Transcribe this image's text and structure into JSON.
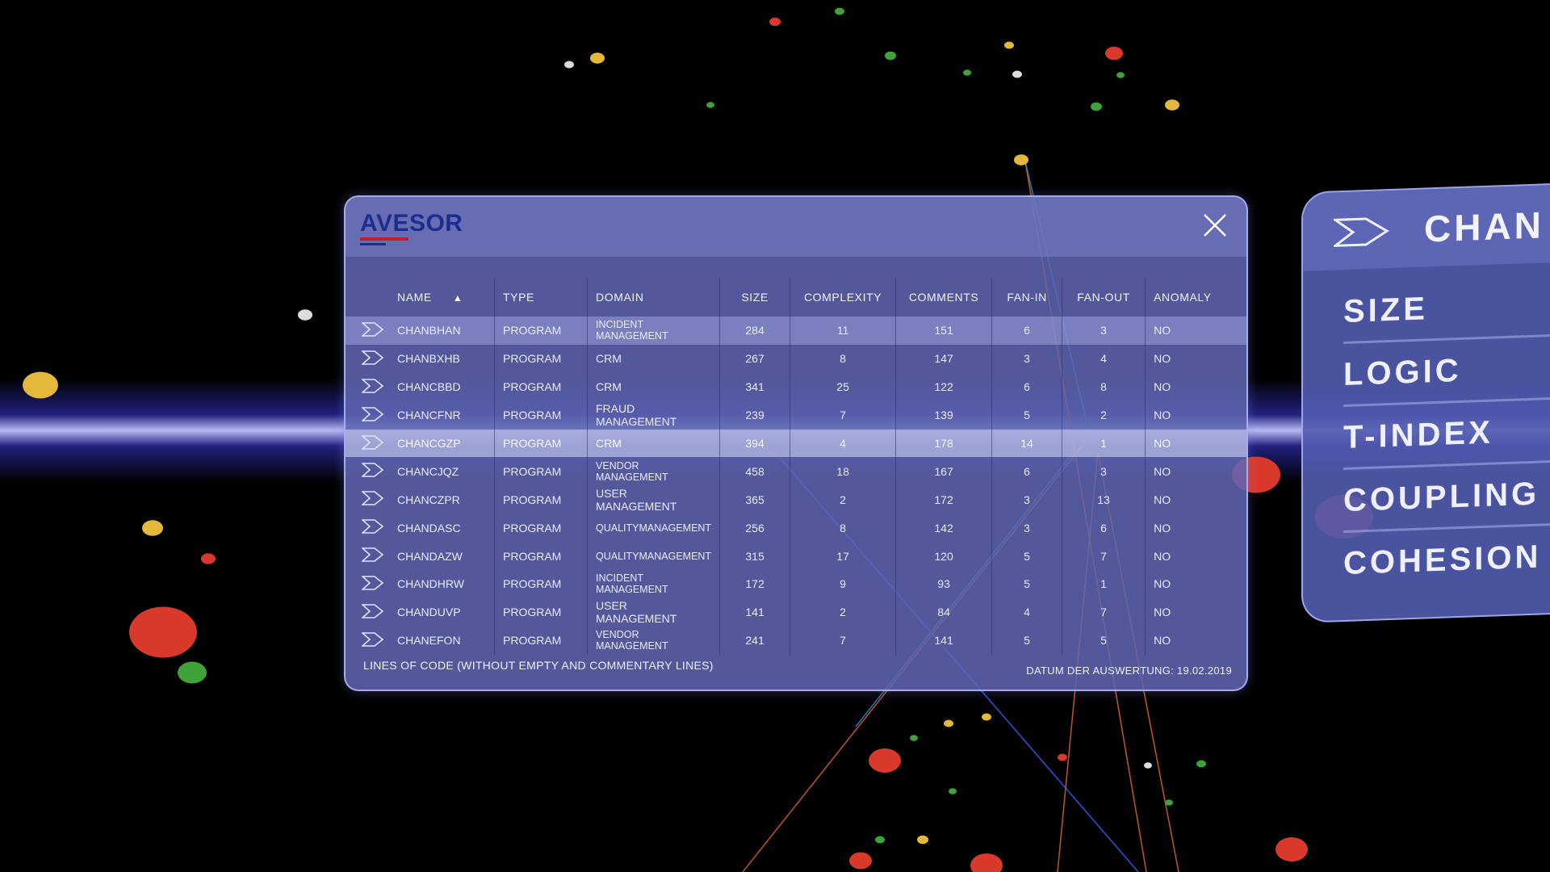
{
  "panel": {
    "logo_text": "AVESOR",
    "columns": [
      "NAME",
      "TYPE",
      "DOMAIN",
      "SIZE",
      "COMPLEXITY",
      "COMMENTS",
      "FAN-IN",
      "FAN-OUT",
      "ANOMALY"
    ],
    "rows": [
      {
        "name": "CHANBHAN",
        "type": "PROGRAM",
        "domain": "INCIDENT MANAGEMENT",
        "size": "284",
        "complexity": "11",
        "comments": "151",
        "fan_in": "6",
        "fan_out": "3",
        "anomaly": "NO"
      },
      {
        "name": "CHANBXHB",
        "type": "PROGRAM",
        "domain": "CRM",
        "size": "267",
        "complexity": "8",
        "comments": "147",
        "fan_in": "3",
        "fan_out": "4",
        "anomaly": "NO"
      },
      {
        "name": "CHANCBBD",
        "type": "PROGRAM",
        "domain": "CRM",
        "size": "341",
        "complexity": "25",
        "comments": "122",
        "fan_in": "6",
        "fan_out": "8",
        "anomaly": "NO"
      },
      {
        "name": "CHANCFNR",
        "type": "PROGRAM",
        "domain": "FRAUD MANAGEMENT",
        "size": "239",
        "complexity": "7",
        "comments": "139",
        "fan_in": "5",
        "fan_out": "2",
        "anomaly": "NO"
      },
      {
        "name": "CHANCGZP",
        "type": "PROGRAM",
        "domain": "CRM",
        "size": "394",
        "complexity": "4",
        "comments": "178",
        "fan_in": "14",
        "fan_out": "1",
        "anomaly": "NO"
      },
      {
        "name": "CHANCJQZ",
        "type": "PROGRAM",
        "domain": "VENDOR MANAGEMENT",
        "size": "458",
        "complexity": "18",
        "comments": "167",
        "fan_in": "6",
        "fan_out": "3",
        "anomaly": "NO"
      },
      {
        "name": "CHANCZPR",
        "type": "PROGRAM",
        "domain": "USER MANAGEMENT",
        "size": "365",
        "complexity": "2",
        "comments": "172",
        "fan_in": "3",
        "fan_out": "13",
        "anomaly": "NO"
      },
      {
        "name": "CHANDASC",
        "type": "PROGRAM",
        "domain": "QUALITYMANAGEMENT",
        "size": "256",
        "complexity": "8",
        "comments": "142",
        "fan_in": "3",
        "fan_out": "6",
        "anomaly": "NO"
      },
      {
        "name": "CHANDAZW",
        "type": "PROGRAM",
        "domain": "QUALITYMANAGEMENT",
        "size": "315",
        "complexity": "17",
        "comments": "120",
        "fan_in": "5",
        "fan_out": "7",
        "anomaly": "NO"
      },
      {
        "name": "CHANDHRW",
        "type": "PROGRAM",
        "domain": "INCIDENT MANAGEMENT",
        "size": "172",
        "complexity": "9",
        "comments": "93",
        "fan_in": "5",
        "fan_out": "1",
        "anomaly": "NO"
      },
      {
        "name": "CHANDUVP",
        "type": "PROGRAM",
        "domain": "USER MANAGEMENT",
        "size": "141",
        "complexity": "2",
        "comments": "84",
        "fan_in": "4",
        "fan_out": "7",
        "anomaly": "NO"
      },
      {
        "name": "CHANEFON",
        "type": "PROGRAM",
        "domain": "VENDOR MANAGEMENT",
        "size": "241",
        "complexity": "7",
        "comments": "141",
        "fan_in": "5",
        "fan_out": "5",
        "anomaly": "NO"
      }
    ],
    "footer_left": "LINES OF CODE (WITHOUT EMPTY AND COMMENTARY LINES)",
    "footer_right": "DATUM DER AUSWERTUNG: 19.02.2019"
  },
  "metrics_menu": {
    "title": "CHAN",
    "items": [
      "SIZE",
      "LOGIC",
      "T-INDEX",
      "COUPLING",
      "COHESION"
    ]
  },
  "colors": {
    "panel": "#5f67b2",
    "accent_red": "#c41e2a",
    "logo_blue": "#1d2d8f",
    "node_red": "#d8392a",
    "node_green": "#3fa33a",
    "node_yellow": "#e4b83a"
  },
  "icons": [
    "close-icon",
    "chevron-right-icon"
  ]
}
